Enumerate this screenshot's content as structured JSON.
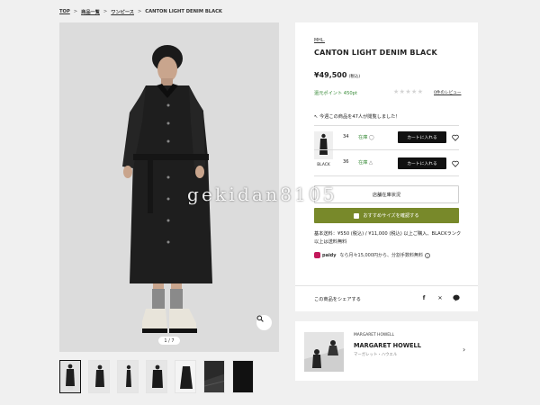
{
  "breadcrumb": {
    "items": [
      "TOP",
      "商品一覧",
      "ワンピース",
      "CANTON LIGHT DENIM BLACK"
    ]
  },
  "gallery": {
    "counter": "1 / 7",
    "thumb_count": 7
  },
  "product": {
    "brand": "MHL.",
    "name": "CANTON LIGHT DENIM BLACK",
    "price": "¥49,500",
    "tax": "(税込)",
    "points": "還元ポイント 450pt",
    "rating_stars": "★★★★★",
    "review_link": "0件のレビュー",
    "watchers": "今週この商品を47人が閲覧しました！"
  },
  "variants": {
    "color": "BLACK",
    "rows": [
      {
        "size": "34",
        "stock": "在庫",
        "stock_mark": "◯",
        "button": "カートに入れる"
      },
      {
        "size": "36",
        "stock": "在庫",
        "stock_mark": "△",
        "button": "カートに入れる"
      }
    ]
  },
  "buttons": {
    "store_stock": "店舗在庫状況",
    "recommend_size": "おすすめサイズを確認する"
  },
  "shipping": {
    "line1": "基本送料：¥550 (税込) / ¥11,000 (税込) 以上ご購入、BLACKランク",
    "line2": "以上は送料無料"
  },
  "paidy": {
    "brand": "paidy",
    "text": "なら月々15,000円から、分割手数料無料"
  },
  "share": {
    "label": "この商品をシェアする",
    "icons": [
      "facebook-icon",
      "x-icon",
      "line-icon"
    ]
  },
  "brand_card": {
    "tag": "MARGARET HOWELL",
    "name": "MARGARET HOWELL",
    "kana": "マーガレット・ハウエル"
  },
  "watermark": "gekidan8105",
  "colors": {
    "accent_green": "#78892a",
    "stock_green": "#3a8c3a",
    "button_black": "#111111",
    "page_bg": "#f0f0f0"
  }
}
